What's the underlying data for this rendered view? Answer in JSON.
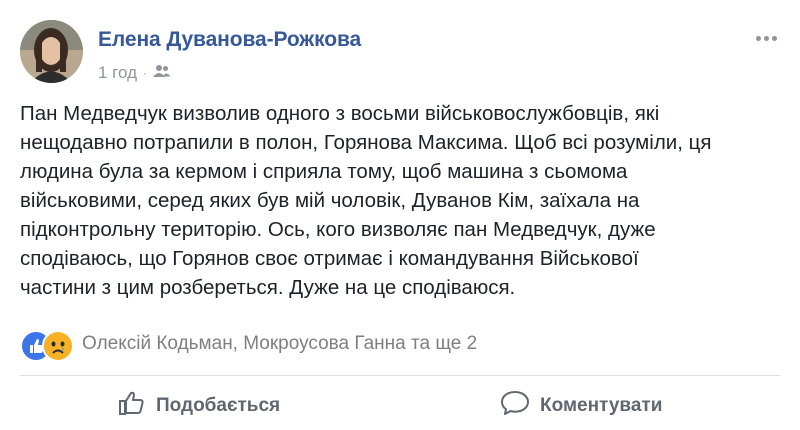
{
  "post": {
    "author": "Елена Дуванова-Рожкова",
    "time": "1 год",
    "separator": "·",
    "privacy_icon": "friends-icon",
    "more_icon": "more-options-icon",
    "body_lines": [
      "Пан Медведчук визволив одного з восьми військовослужбовців, які",
      "нещодавно потрапили в полон, Горянова Максима. Щоб всі розуміли, ця",
      "людина була за кермом і сприяла тому, щоб машина з сьомома",
      "військовими, серед яких був мій чоловік, Дуванов Кім, заїхала на",
      "підконтрольну територію. Ось, кого визволяє пан Медведчук, дуже",
      "сподіваюсь, що Горянов своє отримає і командування Військової",
      "частини з цим розбереться. Дуже на це сподіваюся."
    ]
  },
  "reactions": {
    "types": [
      "like",
      "sad"
    ],
    "summary": "Олексій Кодьман, Мокроусова Ганна та ще 2"
  },
  "actions": {
    "like_label": "Подобається",
    "comment_label": "Коментувати"
  },
  "colors": {
    "author": "#365899",
    "meta": "#90949c",
    "text": "#1d2129",
    "like_reaction": "#3b75e8",
    "sad_reaction": "#f7b125",
    "action_text": "#606770"
  }
}
